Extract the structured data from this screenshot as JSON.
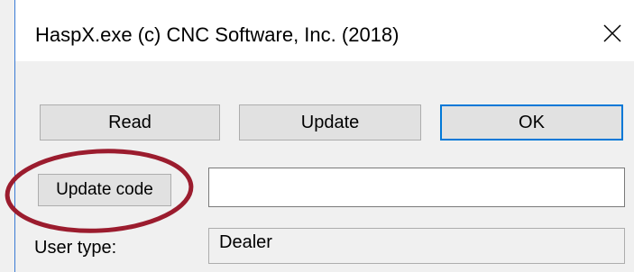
{
  "window": {
    "title": "HaspX.exe (c) CNC Software, Inc. (2018)",
    "close_icon": "close-icon"
  },
  "buttons": {
    "read_label": "Read",
    "update_label": "Update",
    "ok_label": "OK",
    "update_code_label": "Update code"
  },
  "update_code_field": {
    "value": "",
    "placeholder": ""
  },
  "user_type": {
    "label": "User type:",
    "value": "Dealer"
  },
  "colors": {
    "accent": "#0078d7",
    "annotation": "#9b1c2e"
  }
}
